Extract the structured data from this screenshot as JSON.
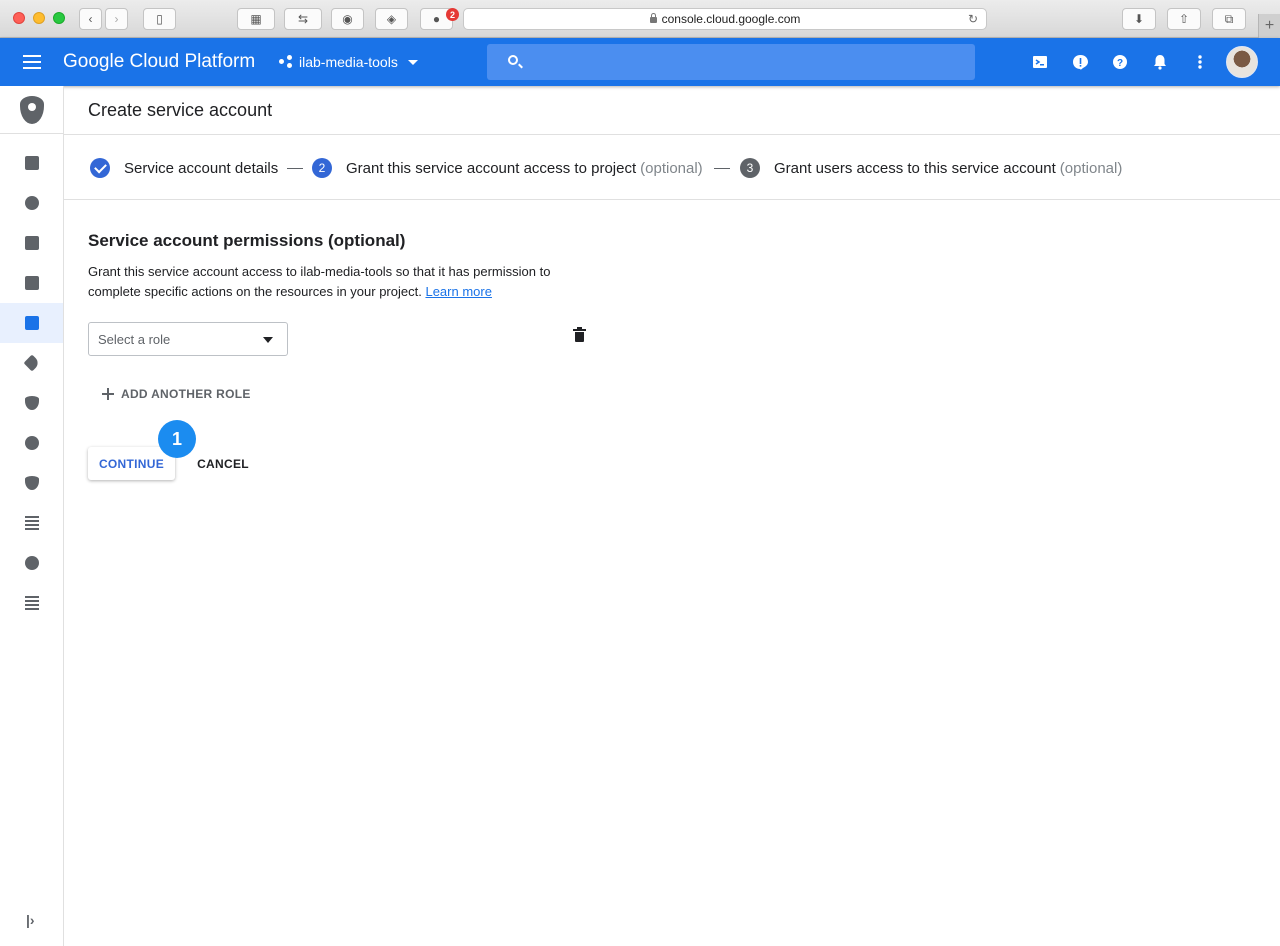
{
  "browser": {
    "url": "console.cloud.google.com",
    "extension_badge": "2"
  },
  "header": {
    "brand": "Google Cloud Platform",
    "project": "ilab-media-tools",
    "search_placeholder": ""
  },
  "page": {
    "title": "Create service account"
  },
  "stepper": {
    "steps": [
      {
        "number": "",
        "label": "Service account details",
        "optional": "",
        "state": "done"
      },
      {
        "number": "2",
        "label": "Grant this service account access to project",
        "optional": "(optional)",
        "state": "current"
      },
      {
        "number": "3",
        "label": "Grant users access to this service account",
        "optional": "(optional)",
        "state": "todo"
      }
    ]
  },
  "permissions": {
    "title": "Service account permissions (optional)",
    "description": "Grant this service account access to ilab-media-tools so that it has permission to complete specific actions on the resources in your project.",
    "learn_more": "Learn more",
    "role_placeholder": "Select a role",
    "add_role": "ADD ANOTHER ROLE"
  },
  "actions": {
    "continue": "CONTINUE",
    "cancel": "CANCEL",
    "callout": "1"
  },
  "colors": {
    "header_blue": "#1a73e8",
    "step_blue": "#3367d6",
    "callout_blue": "#1b8cf0"
  },
  "icons": {
    "header": [
      "cloud-shell-icon",
      "feedback-icon",
      "help-icon",
      "notifications-icon",
      "more-vert-icon"
    ],
    "sidebar": [
      "iam-shield-icon",
      "add-person-icon",
      "account-icon",
      "document-icon",
      "audit-icon",
      "service-account-icon",
      "label-icon",
      "security-icon",
      "settings-icon",
      "privacy-icon",
      "table-icon",
      "workload-icon",
      "list-icon",
      "expand-icon"
    ]
  }
}
